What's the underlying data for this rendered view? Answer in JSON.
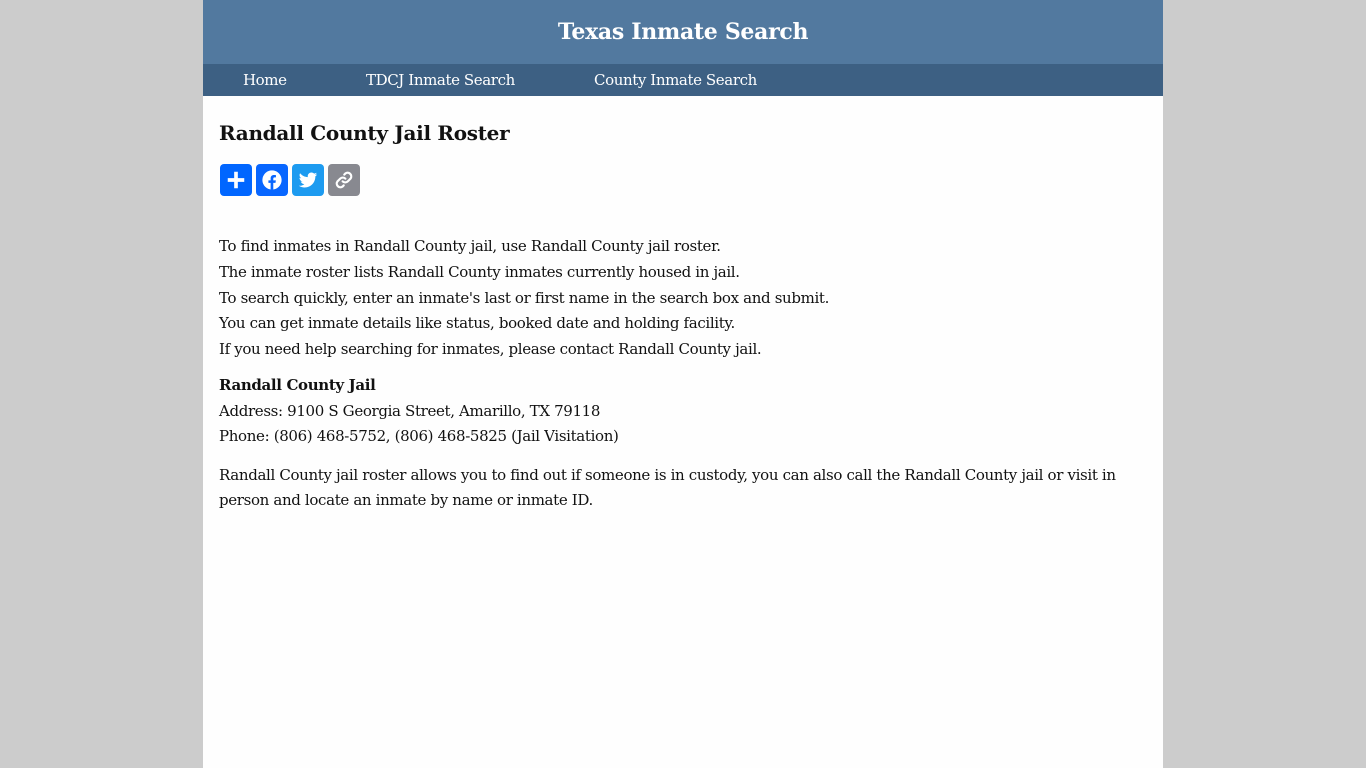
{
  "header": {
    "site_title": "Texas Inmate Search"
  },
  "nav": {
    "items": [
      {
        "label": "Home"
      },
      {
        "label": "TDCJ Inmate Search"
      },
      {
        "label": "County Inmate Search"
      }
    ]
  },
  "main": {
    "page_title": "Randall County Jail Roster",
    "share_buttons": [
      {
        "icon": "plus-icon",
        "label": "Share",
        "color": "#0166ff"
      },
      {
        "icon": "facebook-icon",
        "label": "Facebook",
        "color": "#0866ff"
      },
      {
        "icon": "twitter-icon",
        "label": "Twitter",
        "color": "#1d9bf0"
      },
      {
        "icon": "link-icon",
        "label": "Copy Link",
        "color": "#888990"
      }
    ],
    "intro_lines": [
      "To find inmates in Randall County jail, use Randall County jail roster.",
      "The inmate roster lists Randall County inmates currently housed in jail.",
      "To search quickly, enter an inmate's last or first name in the search box and submit.",
      "You can get inmate details like status, booked date and holding facility.",
      "If you need help searching for inmates, please contact Randall County jail."
    ],
    "jail": {
      "name": "Randall County Jail",
      "address": "Address: 9100 S Georgia Street, Amarillo, TX 79118",
      "phone": "Phone: (806) 468-5752, (806) 468-5825 (Jail Visitation)"
    },
    "closing": "Randall County jail roster allows you to find out if someone is in custody, you can also call the Randall County jail or visit in person and locate an inmate by name or inmate ID."
  }
}
